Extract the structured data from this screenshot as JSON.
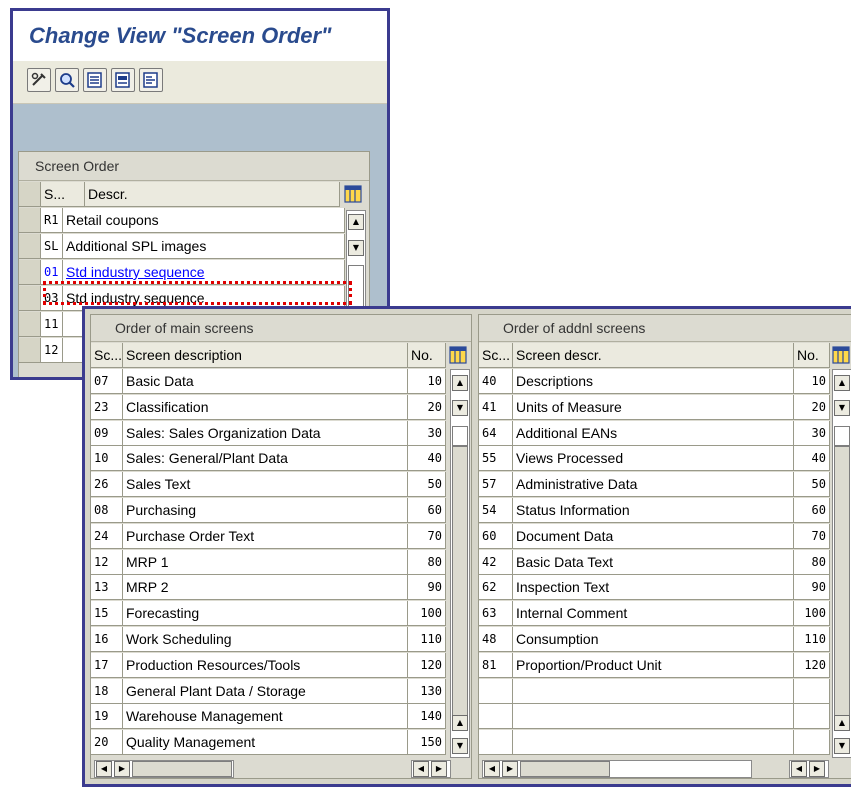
{
  "window": {
    "title": "Change View \"Screen Order\""
  },
  "toolbar": {
    "buttons": [
      {
        "name": "display-change-icon"
      },
      {
        "name": "search-icon"
      },
      {
        "name": "select-all-icon"
      },
      {
        "name": "select-block-icon"
      },
      {
        "name": "deselect-all-icon"
      }
    ]
  },
  "screen_order": {
    "title": "Screen Order",
    "headers": [
      "S...",
      "Descr."
    ],
    "rows": [
      {
        "code": "R1",
        "descr": "Retail coupons"
      },
      {
        "code": "SL",
        "descr": "Additional SPL images"
      },
      {
        "code": "01",
        "descr": "Std industry sequence"
      },
      {
        "code": "03",
        "descr": "Std industry sequence"
      },
      {
        "code": "11",
        "descr": ""
      },
      {
        "code": "12",
        "descr": ""
      }
    ]
  },
  "main_screens": {
    "title": "Order of main screens",
    "headers": [
      "Sc...",
      "Screen description",
      "No."
    ],
    "rows": [
      {
        "code": "07",
        "descr": "Basic Data",
        "no": "10"
      },
      {
        "code": "23",
        "descr": "Classification",
        "no": "20"
      },
      {
        "code": "09",
        "descr": "Sales: Sales Organization Data",
        "no": "30"
      },
      {
        "code": "10",
        "descr": "Sales: General/Plant Data",
        "no": "40"
      },
      {
        "code": "26",
        "descr": "Sales Text",
        "no": "50"
      },
      {
        "code": "08",
        "descr": "Purchasing",
        "no": "60"
      },
      {
        "code": "24",
        "descr": "Purchase Order Text",
        "no": "70"
      },
      {
        "code": "12",
        "descr": "MRP 1",
        "no": "80"
      },
      {
        "code": "13",
        "descr": "MRP 2",
        "no": "90"
      },
      {
        "code": "15",
        "descr": "Forecasting",
        "no": "100"
      },
      {
        "code": "16",
        "descr": "Work Scheduling",
        "no": "110"
      },
      {
        "code": "17",
        "descr": "Production Resources/Tools",
        "no": "120"
      },
      {
        "code": "18",
        "descr": "General Plant Data / Storage",
        "no": "130"
      },
      {
        "code": "19",
        "descr": "Warehouse Management",
        "no": "140"
      },
      {
        "code": "20",
        "descr": "Quality Management",
        "no": "150"
      }
    ]
  },
  "addnl_screens": {
    "title": "Order of addnl screens",
    "headers": [
      "Sc...",
      "Screen descr.",
      "No."
    ],
    "rows": [
      {
        "code": "40",
        "descr": "Descriptions",
        "no": "10"
      },
      {
        "code": "41",
        "descr": "Units of Measure",
        "no": "20"
      },
      {
        "code": "64",
        "descr": "Additional EANs",
        "no": "30"
      },
      {
        "code": "55",
        "descr": "Views Processed",
        "no": "40"
      },
      {
        "code": "57",
        "descr": "Administrative Data",
        "no": "50"
      },
      {
        "code": "54",
        "descr": "Status Information",
        "no": "60"
      },
      {
        "code": "60",
        "descr": "Document Data",
        "no": "70"
      },
      {
        "code": "42",
        "descr": "Basic Data Text",
        "no": "80"
      },
      {
        "code": "62",
        "descr": "Inspection Text",
        "no": "90"
      },
      {
        "code": "63",
        "descr": "Internal Comment",
        "no": "100"
      },
      {
        "code": "48",
        "descr": "Consumption",
        "no": "110"
      },
      {
        "code": "81",
        "descr": "Proportion/Product Unit",
        "no": "120"
      },
      {
        "code": "",
        "descr": "",
        "no": ""
      },
      {
        "code": "",
        "descr": "",
        "no": ""
      },
      {
        "code": "",
        "descr": "",
        "no": ""
      }
    ]
  },
  "colors": {
    "title_text": "#2a4b8e",
    "window_border": "#3b3b8f",
    "highlight": "#e00000",
    "selected_row_text": "#0000ff"
  }
}
